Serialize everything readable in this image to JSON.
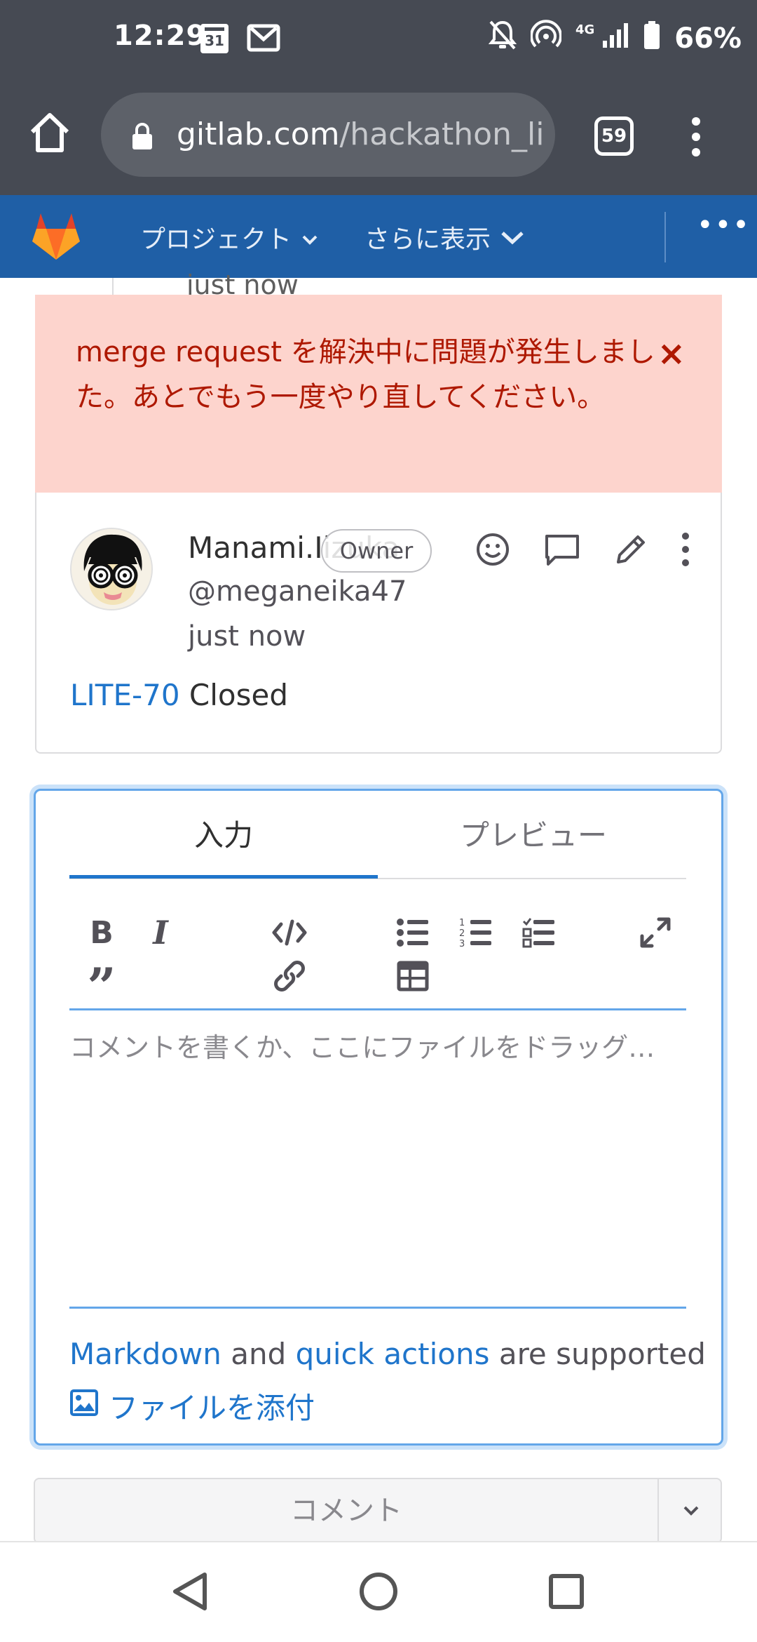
{
  "status_bar": {
    "time": "12:29",
    "calendar_day": "31",
    "network": "4G",
    "battery": "66%"
  },
  "browser": {
    "url_host": "gitlab.com",
    "url_path": "/hackathon_li",
    "tab_count": "59"
  },
  "gitlab_nav": {
    "projects_label": "プロジェクト",
    "more_label": "さらに表示",
    "ellipsis": "•••"
  },
  "previous_note": {
    "time": "just now"
  },
  "alert": {
    "message": "merge request を解決中に問題が発生しました。あとでもう一度やり直してください。",
    "close": "×"
  },
  "note": {
    "author_name": "Manami.Iizuka",
    "badge": "Owner",
    "handle": "@meganeika47",
    "time": "just now",
    "issue_link": "LITE-70",
    "status_text": " Closed"
  },
  "comment_form": {
    "tab_input": "入力",
    "tab_preview": "プレビュー",
    "toolbar": {
      "bold": "B",
      "italic": "I",
      "quote": "”"
    },
    "placeholder": "コメントを書くか、ここにファイルをドラッグ…",
    "md_link": "Markdown",
    "and_text": " and ",
    "quick_actions_link": "quick actions",
    "supported_text": " are supported",
    "attach_label": "ファイルを添付"
  },
  "comment_button": {
    "label": "コメント"
  },
  "colors": {
    "status_bar": "#464a53",
    "gitlab_nav": "#1f5fa6",
    "alert_bg": "#fdd4cd",
    "alert_text": "#ae1800",
    "link": "#1f75cb",
    "focus": "#63a6e9"
  }
}
